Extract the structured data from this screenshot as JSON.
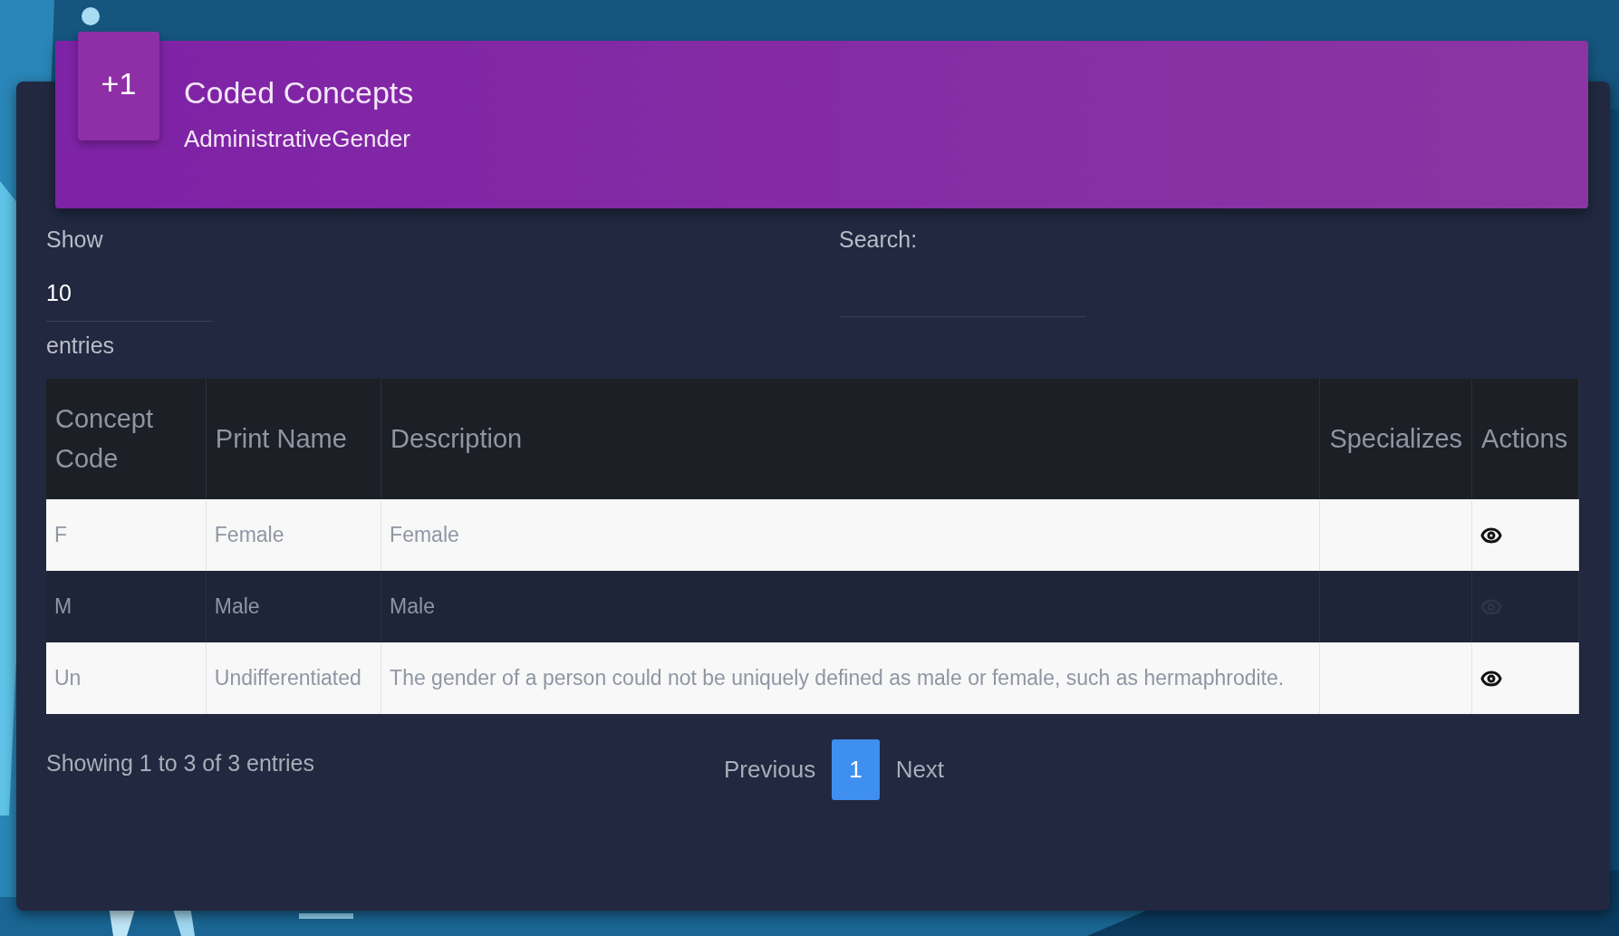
{
  "header": {
    "badge": "+1",
    "title": "Coded Concepts",
    "subtitle": "AdministrativeGender"
  },
  "length": {
    "label_before": "Show",
    "value": "10",
    "label_after": "entries"
  },
  "search": {
    "label": "Search:"
  },
  "table": {
    "columns": [
      "Concept Code",
      "Print Name",
      "Description",
      "Specializes",
      "Actions"
    ],
    "rows": [
      {
        "code": "F",
        "print_name": "Female",
        "description": "Female",
        "specializes": ""
      },
      {
        "code": "M",
        "print_name": "Male",
        "description": "Male",
        "specializes": ""
      },
      {
        "code": "Un",
        "print_name": "Undifferentiated",
        "description": "The gender of a person could not be uniquely defined as male or female, such as hermaphrodite.",
        "specializes": ""
      }
    ]
  },
  "info": "Showing 1 to 3 of 3 entries",
  "pagination": {
    "previous": "Previous",
    "pages": [
      {
        "label": "1",
        "selected": true
      }
    ],
    "next": "Next"
  }
}
